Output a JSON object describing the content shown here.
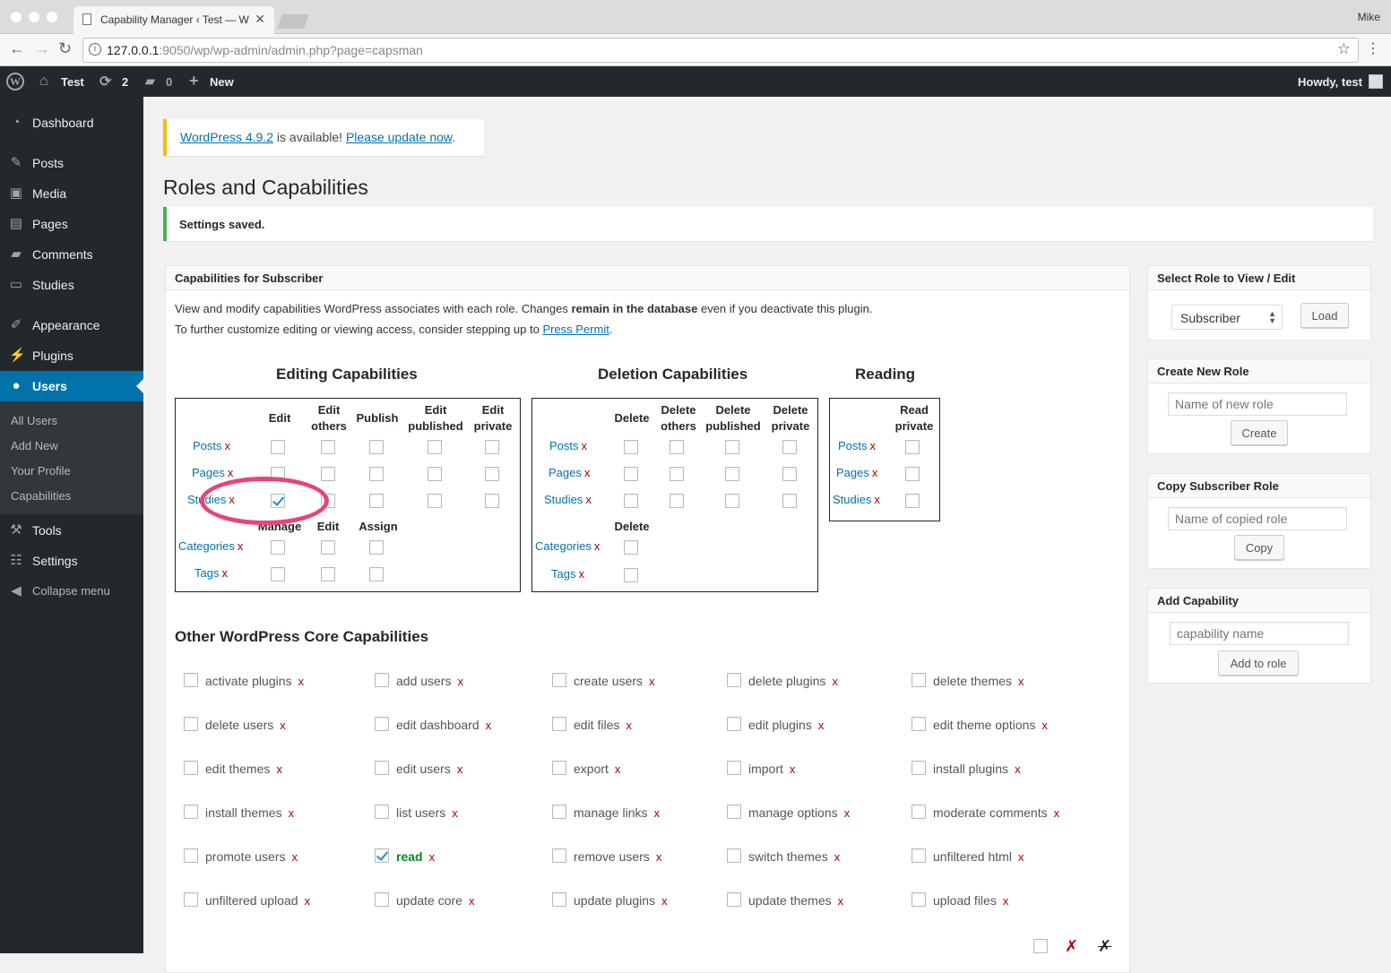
{
  "browser": {
    "tab_title": "Capability Manager ‹ Test — W",
    "user": "Mike",
    "url_host": "127.0.0.1",
    "url_rest": ":9050/wp/wp-admin/admin.php?page=capsman"
  },
  "adminbar": {
    "site": "Test",
    "updates": "2",
    "comments": "0",
    "new": "New",
    "howdy": "Howdy, test"
  },
  "sidebar": {
    "items": [
      {
        "label": "Dashboard",
        "icon": "dashboard-icon"
      },
      {
        "label": "Posts",
        "icon": "pin-icon"
      },
      {
        "label": "Media",
        "icon": "media-icon"
      },
      {
        "label": "Pages",
        "icon": "page-icon"
      },
      {
        "label": "Comments",
        "icon": "comment-icon"
      },
      {
        "label": "Studies",
        "icon": "monitor-icon"
      },
      {
        "label": "Appearance",
        "icon": "brush-icon"
      },
      {
        "label": "Plugins",
        "icon": "plug-icon"
      },
      {
        "label": "Users",
        "icon": "user-icon"
      },
      {
        "label": "Tools",
        "icon": "wrench-icon"
      },
      {
        "label": "Settings",
        "icon": "sliders-icon"
      },
      {
        "label": "Collapse menu",
        "icon": "collapse-icon"
      }
    ],
    "submenu": [
      "All Users",
      "Add New",
      "Your Profile",
      "Capabilities"
    ]
  },
  "notice": {
    "version_link": "WordPress 4.9.2",
    "middle": " is available! ",
    "update_link": "Please update now",
    "end": "."
  },
  "page_title": "Roles and Capabilities",
  "saved": "Settings saved.",
  "capbox": {
    "title": "Capabilities for Subscriber",
    "intro1_a": "View and modify capabilities WordPress associates with each role. Changes ",
    "intro1_b": "remain in the database",
    "intro1_c": " even if you deactivate this plugin.",
    "intro2_a": "To further customize editing or viewing access, consider stepping up to ",
    "intro2_link": "Press Permit",
    "intro2_c": "."
  },
  "sections": {
    "editing": "Editing Capabilities",
    "deletion": "Deletion Capabilities",
    "reading": "Reading"
  },
  "editing_headers": [
    "Edit",
    "Edit others",
    "Publish",
    "Edit published",
    "Edit private"
  ],
  "taxonomy_headers": [
    "Manage",
    "Edit",
    "Assign"
  ],
  "deletion_headers": [
    "Delete",
    "Delete others",
    "Delete published",
    "Delete private"
  ],
  "deletion_tax_header": "Delete",
  "reading_header": "Read private",
  "post_types": [
    "Posts",
    "Pages",
    "Studies"
  ],
  "taxonomies": [
    "Categories",
    "Tags"
  ],
  "remove_mark": "x",
  "other_title": "Other WordPress Core Capabilities",
  "other_caps": [
    [
      "activate plugins",
      "add users",
      "create users",
      "delete plugins",
      "delete themes"
    ],
    [
      "delete users",
      "edit dashboard",
      "edit files",
      "edit plugins",
      "edit theme options"
    ],
    [
      "edit themes",
      "edit users",
      "export",
      "import",
      "install plugins"
    ],
    [
      "install themes",
      "list users",
      "manage links",
      "manage options",
      "moderate comments"
    ],
    [
      "promote users",
      "read",
      "remove users",
      "switch themes",
      "unfiltered html"
    ],
    [
      "unfiltered upload",
      "update core",
      "update plugins",
      "update themes",
      "upload files"
    ]
  ],
  "side": {
    "select_title": "Select Role to View / Edit",
    "selected_role": "Subscriber",
    "load": "Load",
    "create_title": "Create New Role",
    "create_placeholder": "Name of new role",
    "create_btn": "Create",
    "copy_title": "Copy Subscriber Role",
    "copy_placeholder": "Name of copied role",
    "copy_btn": "Copy",
    "add_title": "Add Capability",
    "add_placeholder": "capability name",
    "add_btn": "Add to role"
  },
  "colors": {
    "accent": "#0073aa",
    "highlight_ring": "#e8437a",
    "saved": "#46b450",
    "update": "#ffb900"
  }
}
